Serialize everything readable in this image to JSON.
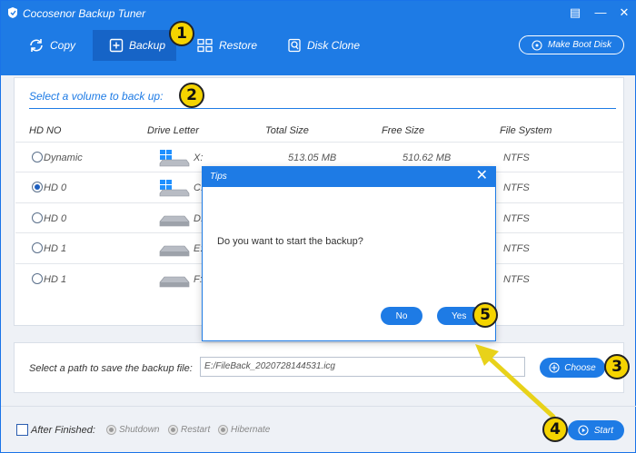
{
  "app": {
    "title": "Cocosenor Backup Tuner",
    "minimize": "▤",
    "maximize": "—",
    "close": "✕"
  },
  "toolbar": {
    "copy": "Copy",
    "backup": "Backup",
    "restore": "Restore",
    "disk_clone": "Disk Clone",
    "make_boot_disk": "Make Boot Disk"
  },
  "volume_panel": {
    "title": "Select a volume to back up:",
    "columns": [
      "HD NO",
      "Drive Letter",
      "Total Size",
      "Free Size",
      "File System"
    ],
    "rows": [
      {
        "hd": "Dynamic",
        "letter": "X:",
        "total": "513.05 MB",
        "free": "510.62 MB",
        "fs": "NTFS",
        "selected": false,
        "icon": "windows-drive-icon"
      },
      {
        "hd": "HD 0",
        "letter": "C:",
        "total": "",
        "free": "",
        "fs": "NTFS",
        "selected": true,
        "icon": "windows-drive-icon"
      },
      {
        "hd": "HD 0",
        "letter": "D:",
        "total": "",
        "free": "",
        "fs": "NTFS",
        "selected": false,
        "icon": "drive-icon"
      },
      {
        "hd": "HD 1",
        "letter": "E:",
        "total": "",
        "free": "",
        "fs": "NTFS",
        "selected": false,
        "icon": "drive-icon"
      },
      {
        "hd": "HD 1",
        "letter": "F:",
        "total": "",
        "free": "",
        "fs": "NTFS",
        "selected": false,
        "icon": "drive-icon"
      }
    ]
  },
  "path_panel": {
    "label": "Select a path to save the backup file:",
    "value": "E:/FileBack_20207281445​31.icg",
    "choose": "Choose"
  },
  "footer": {
    "after_finished": "After Finished:",
    "options": [
      "Shutdown",
      "Restart",
      "Hibernate"
    ],
    "start": "Start"
  },
  "dialog": {
    "title": "Tips",
    "close": "✕",
    "message": "Do you want to start the backup?",
    "no": "No",
    "yes": "Yes"
  },
  "badges": [
    "1",
    "2",
    "3",
    "4",
    "5"
  ],
  "colors": {
    "accent": "#1e7be5",
    "badge": "#f5d400",
    "arrow": "#e8d21a"
  }
}
